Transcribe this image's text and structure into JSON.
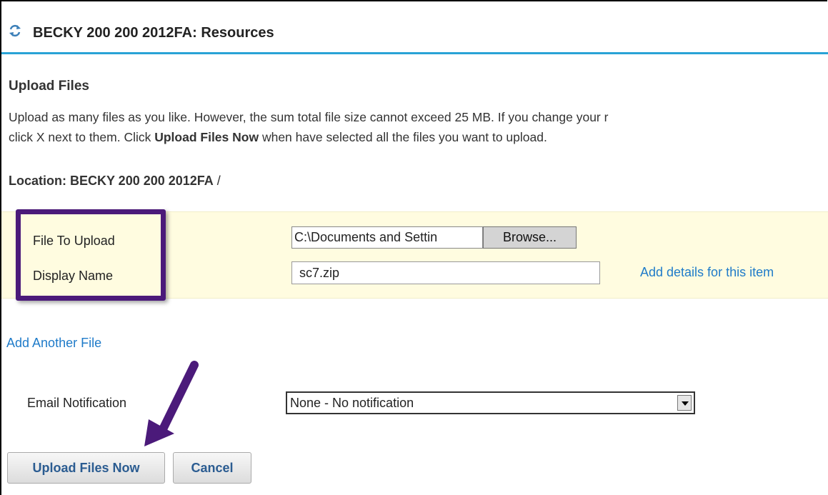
{
  "header": {
    "title": "BECKY 200 200 2012FA: Resources",
    "icon": "refresh-icon"
  },
  "upload": {
    "section_title": "Upload Files",
    "desc_line1": "Upload as many files as you like. However, the sum total file size cannot exceed 25 MB. If you change your r",
    "desc_line2_pre": "click X next to them. Click ",
    "desc_line2_bold": "Upload Files Now",
    "desc_line2_post": " when have selected all the files you want to upload.",
    "location_label": "Location: BECKY 200 200 2012FA",
    "location_slash": " /",
    "file_label": "File To Upload",
    "file_value": "C:\\Documents and Settin",
    "browse_label": "Browse...",
    "display_label": "Display Name",
    "display_value": "sc7.zip",
    "details_link": "Add details for this item",
    "add_another": "Add Another File"
  },
  "notification": {
    "label": "Email Notification",
    "selected": "None - No notification"
  },
  "buttons": {
    "upload_now": "Upload Files Now",
    "cancel": "Cancel"
  },
  "colors": {
    "accent": "#29a3d6",
    "highlight": "#4b1a7a",
    "link": "#1f7bc9",
    "panel": "#fffce0"
  }
}
